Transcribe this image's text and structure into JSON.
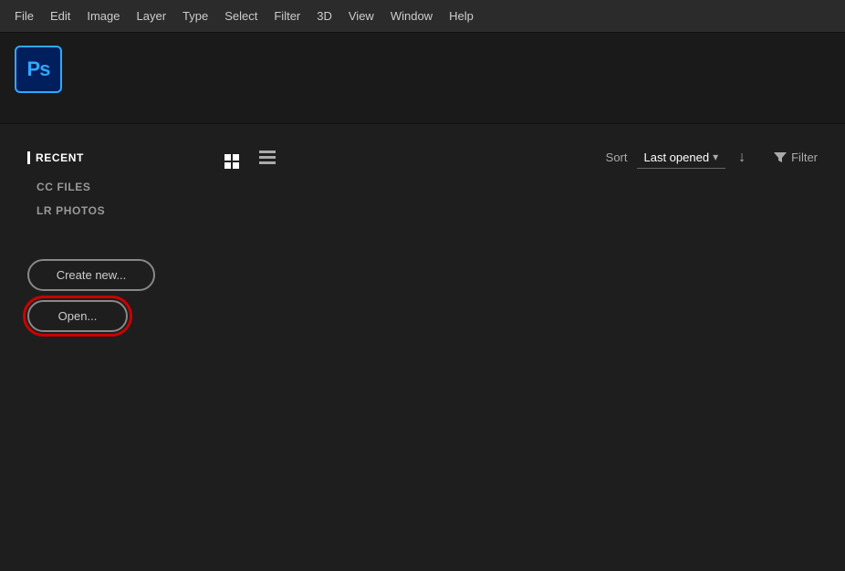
{
  "menubar": {
    "items": [
      "File",
      "Edit",
      "Image",
      "Layer",
      "Type",
      "Select",
      "Filter",
      "3D",
      "View",
      "Window",
      "Help"
    ]
  },
  "logo": {
    "text": "Ps"
  },
  "sidebar": {
    "section_title": "RECENT",
    "items": [
      "CC FILES",
      "LR PHOTOS"
    ],
    "create_button": "Create new...",
    "open_button": "Open..."
  },
  "toolbar": {
    "sort_label": "Sort",
    "sort_value": "Last opened",
    "filter_label": "Filter"
  }
}
